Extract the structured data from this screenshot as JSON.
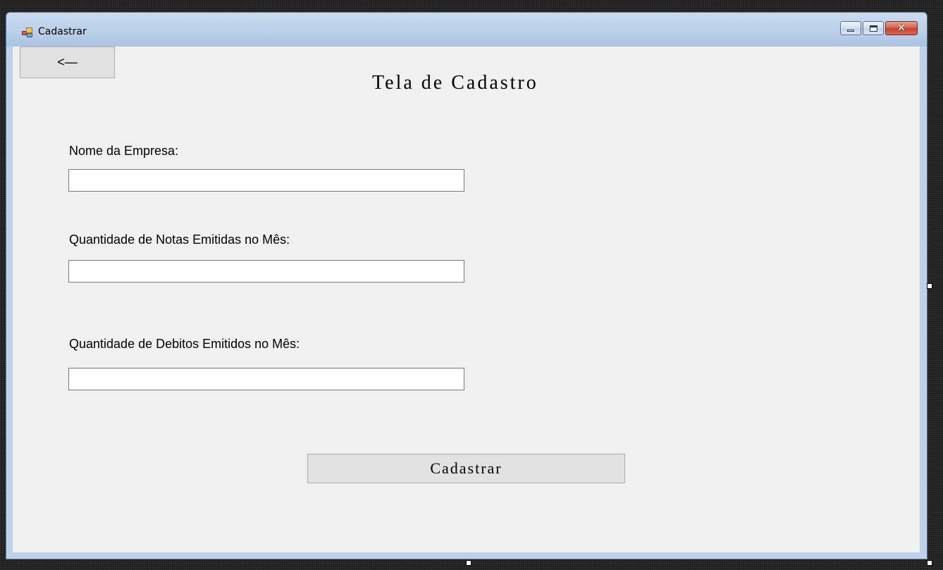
{
  "window": {
    "title": "Cadastrar"
  },
  "toolbar": {
    "back_label": "<—"
  },
  "page": {
    "title": "Tela de Cadastro"
  },
  "form": {
    "company_name_label": "Nome da Empresa:",
    "company_name_value": "",
    "notes_label": "Quantidade de Notas Emitidas no Mês:",
    "notes_value": "",
    "debits_label": "Quantidade de Debitos Emitidos no Mês:",
    "debits_value": "",
    "submit_label": "Cadastrar"
  },
  "colors": {
    "client_background": "#f0f0f0",
    "button_background": "#e1e1e1",
    "close_button": "#c4412b",
    "designer_background": "#1e1e1e"
  },
  "icons": [
    "app-form-icon",
    "minimize-icon",
    "maximize-icon",
    "close-icon"
  ]
}
